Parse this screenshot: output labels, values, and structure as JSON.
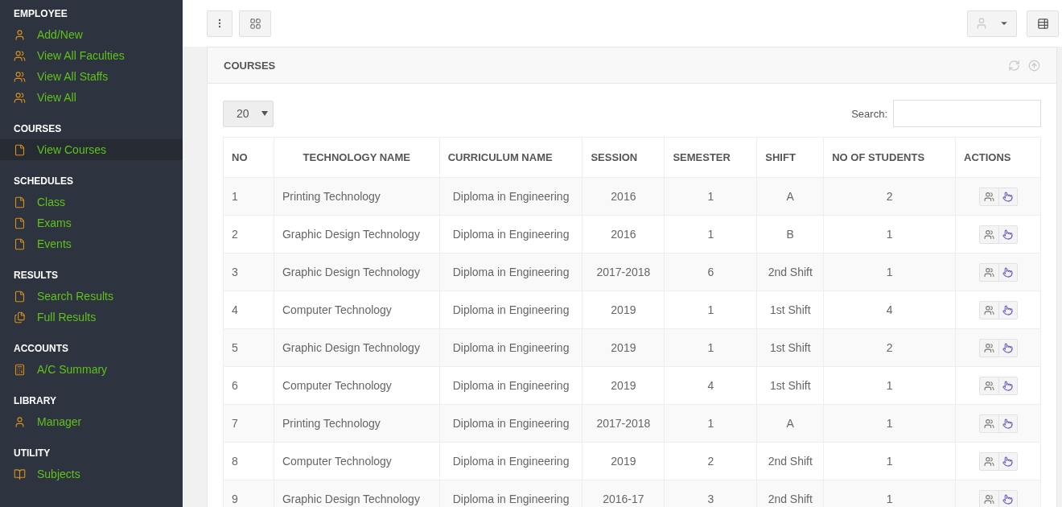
{
  "sidebar": {
    "sections": [
      {
        "heading": "EMPLOYEE",
        "items": [
          {
            "label": "Add/New",
            "selected": false
          },
          {
            "label": "View All Faculties",
            "selected": false
          },
          {
            "label": "View All Staffs",
            "selected": false
          },
          {
            "label": "View All",
            "selected": false
          }
        ]
      },
      {
        "heading": "COURSES",
        "items": [
          {
            "label": "View Courses",
            "selected": true
          }
        ]
      },
      {
        "heading": "SCHEDULES",
        "items": [
          {
            "label": "Class",
            "selected": false
          },
          {
            "label": "Exams",
            "selected": false
          },
          {
            "label": "Events",
            "selected": false
          }
        ]
      },
      {
        "heading": "RESULTS",
        "items": [
          {
            "label": "Search Results",
            "selected": false
          },
          {
            "label": "Full Results",
            "selected": false
          }
        ]
      },
      {
        "heading": "ACCOUNTS",
        "items": [
          {
            "label": "A/C Summary",
            "selected": false
          }
        ]
      },
      {
        "heading": "LIBRARY",
        "items": [
          {
            "label": "Manager",
            "selected": false
          }
        ]
      },
      {
        "heading": "UTILITY",
        "items": [
          {
            "label": "Subjects",
            "selected": false
          }
        ]
      }
    ]
  },
  "panel": {
    "title": "COURSES",
    "page_size": "20",
    "search_label": "Search:",
    "table": {
      "columns": [
        "NO",
        "TECHNOLOGY NAME",
        "CURRICULUM NAME",
        "SESSION",
        "SEMESTER",
        "SHIFT",
        "NO OF STUDENTS",
        "ACTIONS"
      ],
      "rows": [
        [
          "1",
          "Printing Technology",
          "Diploma in Engineering",
          "2016",
          "1",
          "A",
          "2"
        ],
        [
          "2",
          "Graphic Design Technology",
          "Diploma in Engineering",
          "2016",
          "1",
          "B",
          "1"
        ],
        [
          "3",
          "Graphic Design Technology",
          "Diploma in Engineering",
          "2017-2018",
          "6",
          "2nd Shift",
          "1"
        ],
        [
          "4",
          "Computer Technology",
          "Diploma in Engineering",
          "2019",
          "1",
          "1st Shift",
          "4"
        ],
        [
          "5",
          "Graphic Design Technology",
          "Diploma in Engineering",
          "2019",
          "1",
          "1st Shift",
          "2"
        ],
        [
          "6",
          "Computer Technology",
          "Diploma in Engineering",
          "2019",
          "4",
          "1st Shift",
          "1"
        ],
        [
          "7",
          "Printing Technology",
          "Diploma in Engineering",
          "2017-2018",
          "1",
          "A",
          "1"
        ],
        [
          "8",
          "Computer Technology",
          "Diploma in Engineering",
          "2019",
          "2",
          "2nd Shift",
          "1"
        ],
        [
          "9",
          "Graphic Design Technology",
          "Diploma in Engineering",
          "2016-17",
          "3",
          "2nd Shift",
          "1"
        ]
      ]
    }
  }
}
